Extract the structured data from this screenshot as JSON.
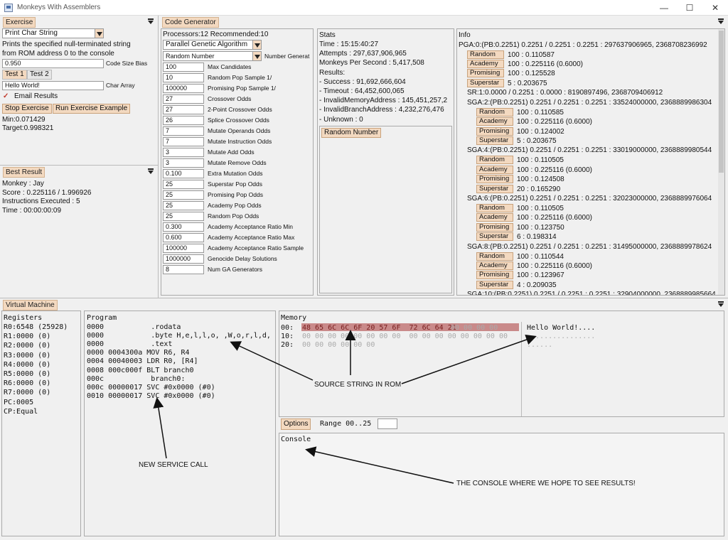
{
  "window": {
    "title": "Monkeys With Assemblers",
    "minimize": "—",
    "maximize": "☐",
    "close": "✕"
  },
  "exercise": {
    "tab": "Exercise",
    "selected": "Print Char String",
    "desc1": "Prints the specified null-terminated string",
    "desc2": "from ROM address 0 to the console",
    "bias_value": "0.950",
    "bias_label": "Code Size Bias",
    "test1": "Test 1",
    "test2": "Test 2",
    "char_array_value": "Hello World!",
    "char_array_label": "Char Array",
    "email_check": "✓",
    "email_label": "Email Results",
    "stop_btn": "Stop Exercise",
    "run_btn": "Run Exercise Example",
    "min": "Min:0.071429",
    "target": "Target:0.998321"
  },
  "best": {
    "tab": "Best Result",
    "lines": [
      "Monkey : Jay",
      "Score : 0.225116 / 1.996926",
      "Instructions Executed : 5",
      "Time : 00:00:00:09"
    ]
  },
  "codegen": {
    "tab": "Code Generator",
    "processors": "Processors:12 Recommended:10",
    "algorithm": "Parallel Genetic Algorithm",
    "generator": "Random Number",
    "generator_label": "Number Generat",
    "params": [
      {
        "value": "100",
        "label": "Max Candidates"
      },
      {
        "value": "10",
        "label": "Random Pop Sample 1/"
      },
      {
        "value": "100000",
        "label": "Promising Pop Sample 1/"
      },
      {
        "value": "27",
        "label": "Crossover Odds"
      },
      {
        "value": "27",
        "label": "2-Point Crossover Odds"
      },
      {
        "value": "26",
        "label": "Splice Crossover Odds"
      },
      {
        "value": "7",
        "label": "Mutate Operands Odds"
      },
      {
        "value": "7",
        "label": "Mutate Instruction Odds"
      },
      {
        "value": "3",
        "label": "Mutate Add Odds"
      },
      {
        "value": "3",
        "label": "Mutate Remove Odds"
      },
      {
        "value": "0.100",
        "label": "Extra Mutation Odds"
      },
      {
        "value": "25",
        "label": "Superstar Pop Odds"
      },
      {
        "value": "25",
        "label": "Promising Pop Odds"
      },
      {
        "value": "25",
        "label": "Academy Pop Odds"
      },
      {
        "value": "25",
        "label": "Random Pop Odds"
      },
      {
        "value": "0.300",
        "label": "Academy Acceptance Ratio Min"
      },
      {
        "value": "0.600",
        "label": "Academy Acceptance Ratio Max"
      },
      {
        "value": "100000",
        "label": "Academy Acceptance Ratio Sample"
      },
      {
        "value": "1000000",
        "label": "Genocide Delay Solutions"
      },
      {
        "value": "8",
        "label": "Num GA Generators"
      }
    ]
  },
  "stats": {
    "title": "Stats",
    "lines": [
      "Time : 15:15:40:27",
      "Attempts : 297,637,906,965",
      "Monkeys Per Second : 5,417,508",
      "Results:",
      "-  Success : 91,692,666,604",
      "-  Timeout : 64,452,600,065",
      "-  InvalidMemoryAddress : 145,451,257,2",
      "-  InvalidBranchAddress : 4,232,276,476",
      "-  Unknown : 0"
    ],
    "random_btn": "Random Number"
  },
  "info": {
    "title": "Info",
    "pga": "PGA:0:(PB:0.2251) 0.2251 / 0.2251  : 0.2251 : 297637906965, 2368708236992",
    "pga_rows": [
      {
        "tag": "Random",
        "val": "100 : 0.110587"
      },
      {
        "tag": "Academy",
        "val": "100 : 0.225116  (0.6000)"
      },
      {
        "tag": "Promising",
        "val": "100 : 0.125528"
      },
      {
        "tag": "Superstar",
        "val": "5 : 0.203675"
      }
    ],
    "sr": "SR:1:0.0000 / 0.2251 : 0.0000 : 8190897496, 2368709406912",
    "groups": [
      {
        "head": "SGA:2:(PB:0.2251) 0.2251 / 0.2251  : 0.2251 : 33524000000, 2368889986304",
        "rows": [
          {
            "tag": "Random",
            "val": "100 : 0.110585"
          },
          {
            "tag": "Academy",
            "val": "100 : 0.225116  (0.6000)"
          },
          {
            "tag": "Promising",
            "val": "100 : 0.124002"
          },
          {
            "tag": "Superstar",
            "val": "5 : 0.203675"
          }
        ]
      },
      {
        "head": "SGA:4:(PB:0.2251) 0.2251 / 0.2251  : 0.2251 : 33019000000, 2368889980544",
        "rows": [
          {
            "tag": "Random",
            "val": "100 : 0.110505"
          },
          {
            "tag": "Academy",
            "val": "100 : 0.225116  (0.6000)"
          },
          {
            "tag": "Promising",
            "val": "100 : 0.124508"
          },
          {
            "tag": "Superstar",
            "val": "20 : 0.165290"
          }
        ]
      },
      {
        "head": "SGA:6:(PB:0.2251) 0.2251 / 0.2251  : 0.2251 : 32023000000, 2368889976064",
        "rows": [
          {
            "tag": "Random",
            "val": "100 : 0.110505"
          },
          {
            "tag": "Academy",
            "val": "100 : 0.225116  (0.6000)"
          },
          {
            "tag": "Promising",
            "val": "100 : 0.123750"
          },
          {
            "tag": "Superstar",
            "val": "6 : 0.198314"
          }
        ]
      },
      {
        "head": "SGA:8:(PB:0.2251) 0.2251 / 0.2251  : 0.2251 : 31495000000, 2368889978624",
        "rows": [
          {
            "tag": "Random",
            "val": "100 : 0.110544"
          },
          {
            "tag": "Academy",
            "val": "100 : 0.225116  (0.6000)"
          },
          {
            "tag": "Promising",
            "val": "100 : 0.123967"
          },
          {
            "tag": "Superstar",
            "val": "4 : 0.209035"
          }
        ]
      }
    ],
    "tail": "SGA:10:(PB:0.2251) 0.2251 / 0.2251  : 0.2251 : 32904000000, 2368889985664"
  },
  "vm": {
    "tab": "Virtual Machine",
    "registers_title": "Registers",
    "registers": [
      "R0:6548 (25928)",
      "R1:0000 (0)",
      "R2:0000 (0)",
      "R3:0000 (0)",
      "R4:0000 (0)",
      "R5:0000 (0)",
      "R6:0000 (0)",
      "R7:0000 (0)",
      "PC:0005",
      "CP:Equal"
    ],
    "program_title": "Program",
    "program": [
      "0000           .rodata",
      "0000           .byte H,e,l,l,o, ,W,o,r,l,d,",
      "0000           .text",
      "0000 0004300a MOV R6, R4",
      "0004 00040003 LDR R0, [R4]",
      "0008 000c000f BLT branch0",
      "000c           branch0:",
      "000c 00000017 SVC #0x0000 (#0)",
      "0010 00000017 SVC #0x0000 (#0)"
    ],
    "memory_title": "Memory",
    "memory": [
      {
        "addr": "00:",
        "hex": "48 65 6C 6C 6F 20 57 6F  72 6C 64 21",
        "tail": "00 00 00 00",
        "ascii": "Hello World!...."
      },
      {
        "addr": "10:",
        "hex": "00 00 00 00 00 00 00 00  00 00 00 00 00 00 00 00",
        "tail": "",
        "ascii": "................"
      },
      {
        "addr": "20:",
        "hex": "00 00 00 00 00 00",
        "tail": "",
        "ascii": "......"
      }
    ],
    "options_btn": "Options",
    "range_label": "Range 00..25",
    "range_value": "",
    "console_title": "Console"
  },
  "annotations": {
    "source": "SOURCE STRING IN ROM",
    "service": "NEW SERVICE CALL",
    "console": "THE CONSOLE WHERE WE HOPE TO SEE RESULTS!"
  }
}
